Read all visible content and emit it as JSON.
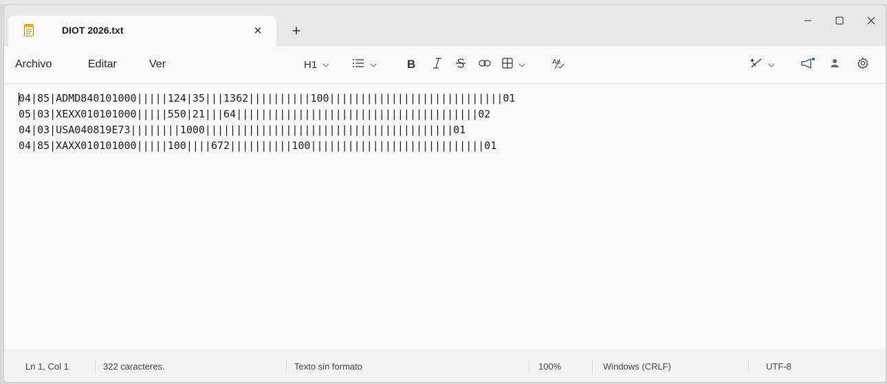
{
  "window": {
    "tab_title": "DIOT 2026.txt",
    "new_tab_label": "+",
    "tab_close_glyph": "×",
    "controls": {
      "minimize": "—",
      "maximize": "□",
      "close": "×"
    }
  },
  "menu": {
    "items": [
      "Archivo",
      "Editar",
      "Ver"
    ],
    "heading_label": "H1"
  },
  "toolbar_icons": [
    "heading-dropdown-icon",
    "list-icon",
    "bold-icon",
    "italic-icon",
    "strikethrough-icon",
    "link-icon",
    "table-icon",
    "spellcheck-icon",
    "copilot-icon",
    "megaphone-icon",
    "account-icon",
    "settings-icon"
  ],
  "editor": {
    "lines": [
      "04|85|ADMD840101000|||||124|35|||1362||||||||||100||||||||||||||||||||||||||||01",
      "05|03|XEXX010101000|||||550|21|||64|||||||||||||||||||||||||||||||||||||||02",
      "04|03|USA040819E73||||||||1000||||||||||||||||||||||||||||||||||||||||01",
      "04|85|XAXX010101000|||||100||||672||||||||||100||||||||||||||||||||||||||||01"
    ]
  },
  "status": {
    "position": "Ln 1, Col 1",
    "chars": "322 caracteres.",
    "format": "Texto sin formato",
    "zoom": "100%",
    "line_ending": "Windows (CRLF)",
    "encoding": "UTF-8"
  },
  "colors": {
    "accent": "#0067c0",
    "notepad_icon": "#e8b400"
  }
}
